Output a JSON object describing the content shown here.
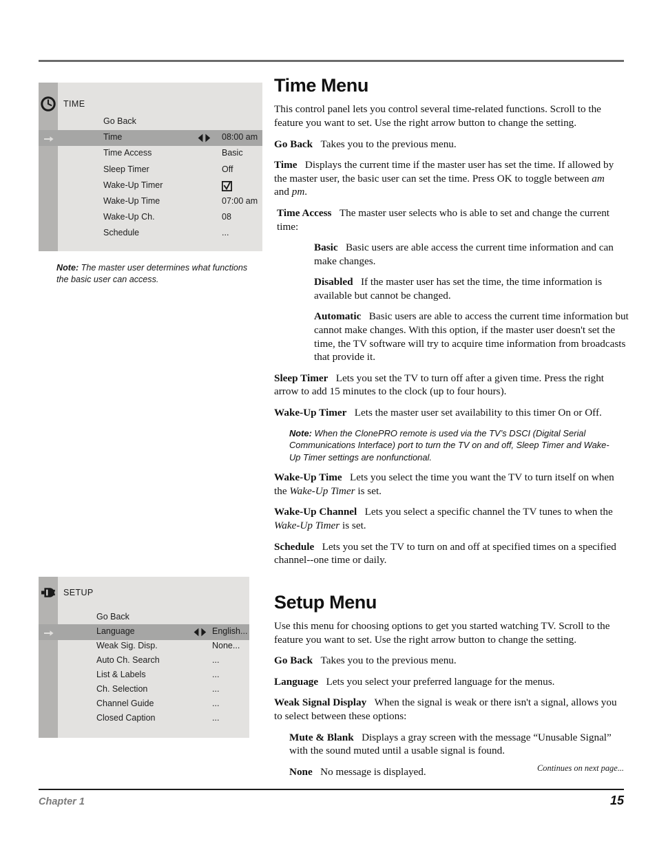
{
  "page": {
    "chapter_label": "Chapter 1",
    "page_number": "15",
    "continues_note": "Continues on next page..."
  },
  "time_menu_osd": {
    "icon": "clock-icon",
    "title": "TIME",
    "rows": [
      {
        "label": "Go Back",
        "value": "",
        "selected": false,
        "arrows": false,
        "checkbox": false
      },
      {
        "label": "Time",
        "value": "08:00 am",
        "selected": true,
        "arrows": true,
        "checkbox": false
      },
      {
        "label": "Time Access",
        "value": "Basic",
        "selected": false,
        "arrows": false,
        "checkbox": false
      },
      {
        "label": "Sleep Timer",
        "value": "Off",
        "selected": false,
        "arrows": false,
        "checkbox": false
      },
      {
        "label": "Wake-Up Timer",
        "value": "",
        "selected": false,
        "arrows": false,
        "checkbox": true
      },
      {
        "label": "Wake-Up Time",
        "value": "07:00 am",
        "selected": false,
        "arrows": false,
        "checkbox": false
      },
      {
        "label": "Wake-Up Ch.",
        "value": "08",
        "selected": false,
        "arrows": false,
        "checkbox": false
      },
      {
        "label": "Schedule",
        "value": "...",
        "selected": false,
        "arrows": false,
        "checkbox": false
      }
    ]
  },
  "time_menu_note": {
    "bold": "Note:",
    "text": " The master user determines what functions the basic user can access."
  },
  "setup_menu_osd": {
    "icon": "plug-connector-icon",
    "title": "SETUP",
    "rows": [
      {
        "label": "Go Back",
        "value": "",
        "selected": false,
        "arrows": false,
        "checkbox": false
      },
      {
        "label": "Language",
        "value": "English...",
        "selected": true,
        "arrows": true,
        "checkbox": false
      },
      {
        "label": "Weak Sig. Disp.",
        "value": "None...",
        "selected": false,
        "arrows": false,
        "checkbox": false
      },
      {
        "label": "Auto Ch. Search",
        "value": "...",
        "selected": false,
        "arrows": false,
        "checkbox": false
      },
      {
        "label": "List & Labels",
        "value": "...",
        "selected": false,
        "arrows": false,
        "checkbox": false
      },
      {
        "label": "Ch. Selection",
        "value": "...",
        "selected": false,
        "arrows": false,
        "checkbox": false
      },
      {
        "label": "Channel Guide",
        "value": "...",
        "selected": false,
        "arrows": false,
        "checkbox": false
      },
      {
        "label": "Closed Caption",
        "value": "...",
        "selected": false,
        "arrows": false,
        "checkbox": false
      }
    ]
  },
  "time_section": {
    "heading": "Time Menu",
    "intro": "This control panel lets you control several time-related functions. Scroll to the feature you want to set. Use the right arrow button to change the setting.",
    "go_back_term": "Go Back",
    "go_back_text": "Takes you to the previous menu.",
    "time_term": "Time",
    "time_text_a": "Displays the current time if the master user has set the time. If allowed by the master user, the basic user can set the time. Press OK to toggle between ",
    "time_em_am": "am",
    "time_text_b": " and ",
    "time_em_pm": "pm",
    "time_text_c": ".",
    "time_access_term": "Time Access",
    "time_access_text": "The master user selects who is able to set and change the current time:",
    "basic_term": "Basic",
    "basic_text": "Basic users are able access the current time information and can make changes.",
    "disabled_term": "Disabled",
    "disabled_text": "If the master user has set the time, the time information is available but cannot be changed.",
    "automatic_term": "Automatic",
    "automatic_text": "Basic users are able to access the current time information but cannot make changes. With this option, if the master user doesn't set the time, the TV software will try to acquire time information from broadcasts that provide it.",
    "sleep_timer_term": "Sleep Timer",
    "sleep_timer_text": "Lets you set the TV to turn off after a given time. Press the right arrow to add 15 minutes to the clock (up to four hours).",
    "wake_up_timer_term": "Wake-Up Timer",
    "wake_up_timer_text": "Lets the master user set availability to this timer On or Off.",
    "dsci_note_bold": "Note:",
    "dsci_note_text": " When the ClonePRO remote is used via the TV’s DSCI (Digital Serial Communications Interface) port to turn the TV on and off, Sleep Timer and Wake-Up Timer settings are nonfunctional.",
    "wake_up_time_term": "Wake-Up Time",
    "wake_up_time_text_a": "Lets you select the time you want the TV to turn itself on when the ",
    "wake_up_time_em": "Wake-Up Timer",
    "wake_up_time_text_b": " is set.",
    "wake_up_channel_term": "Wake-Up Channel",
    "wake_up_channel_text_a": "Lets you select a specific channel the TV tunes to when the ",
    "wake_up_channel_em": "Wake-Up Timer",
    "wake_up_channel_text_b": " is set.",
    "schedule_term": "Schedule",
    "schedule_text": "Lets you set the TV to turn on and off at specified times on a specified channel--one time or daily."
  },
  "setup_section": {
    "heading": "Setup Menu",
    "intro": "Use this menu for choosing options to get you started watching TV. Scroll to the feature you want to set. Use the right arrow button to change the setting.",
    "go_back_term": "Go Back",
    "go_back_text": "Takes you to the previous menu.",
    "language_term": "Language",
    "language_text": "Lets you select your preferred language for the menus.",
    "weak_signal_term": "Weak Signal Display",
    "weak_signal_text": "When the signal is weak or there isn't a signal, allows you to select between these options:",
    "mute_blank_term": "Mute & Blank",
    "mute_blank_text": "Displays a gray screen with the message “Unusable Signal” with the sound muted until a usable signal is found.",
    "none_term": "None",
    "none_text": "No message is displayed."
  },
  "colors": {
    "osd_panel": "#e3e2e0",
    "osd_rail": "#b4b3b1",
    "osd_selected": "#a6a6a5",
    "rule_top": "#6b6b6b",
    "chapter_gray": "#7b7b7b"
  }
}
